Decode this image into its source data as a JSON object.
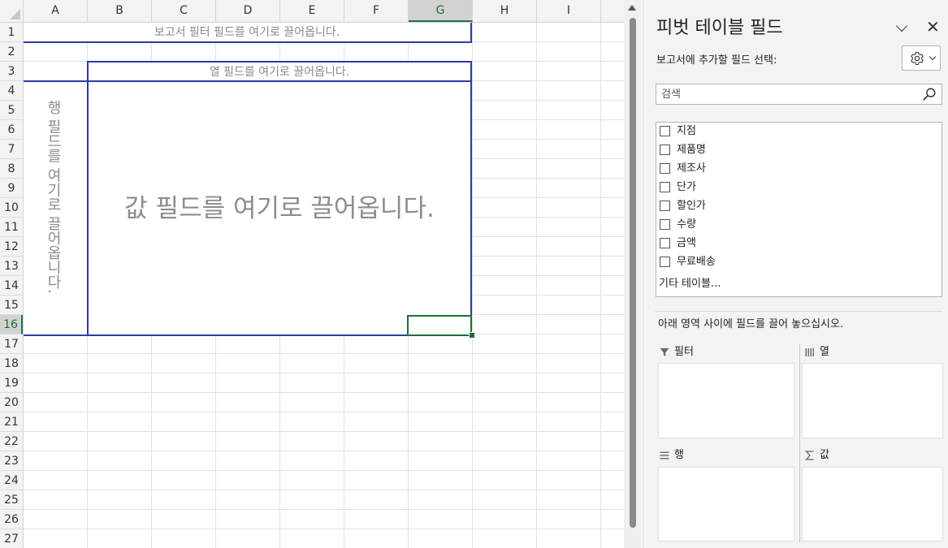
{
  "sheet": {
    "columns": [
      "A",
      "B",
      "C",
      "D",
      "E",
      "F",
      "G",
      "H",
      "I"
    ],
    "selected_column": "G",
    "rows": [
      "1",
      "2",
      "3",
      "4",
      "5",
      "6",
      "7",
      "8",
      "9",
      "10",
      "11",
      "12",
      "13",
      "14",
      "15",
      "16",
      "17",
      "18",
      "19",
      "20",
      "21",
      "22",
      "23",
      "24",
      "25",
      "26",
      "27"
    ],
    "selected_row": "16",
    "pivot": {
      "report_filter_placeholder": "보고서 필터 필드를 여기로 끌어옵니다.",
      "column_field_placeholder": "열 필드를 여기로 끌어옵니다.",
      "row_field_placeholder": "행 필드를 여기로 끌어옵니다.",
      "values_placeholder": "값 필드를 여기로 끌어옵니다."
    }
  },
  "pane": {
    "title": "피벗 테이블 필드",
    "choose_label": "보고서에 추가할 필드 선택:",
    "search_placeholder": "검색",
    "fields": [
      {
        "label": "지점",
        "checked": false
      },
      {
        "label": "제품명",
        "checked": false
      },
      {
        "label": "제조사",
        "checked": false
      },
      {
        "label": "단가",
        "checked": false
      },
      {
        "label": "할인가",
        "checked": false
      },
      {
        "label": "수량",
        "checked": false
      },
      {
        "label": "금액",
        "checked": false
      },
      {
        "label": "무료배송",
        "checked": false
      }
    ],
    "more_tables": "기타 테이블...",
    "drag_hint": "아래 영역 사이에 필드를 끌어 놓으십시오.",
    "areas": {
      "filter": {
        "label": "필터",
        "icon": "filter-icon"
      },
      "columns": {
        "label": "열",
        "icon": "columns-icon"
      },
      "rows": {
        "label": "행",
        "icon": "rows-icon"
      },
      "values": {
        "label": "값",
        "icon": "sigma-icon"
      }
    }
  },
  "colors": {
    "pivot_border": "#2a3bb0",
    "active_cell": "#1e6e3a",
    "pane_bg": "#f3f3f3"
  }
}
